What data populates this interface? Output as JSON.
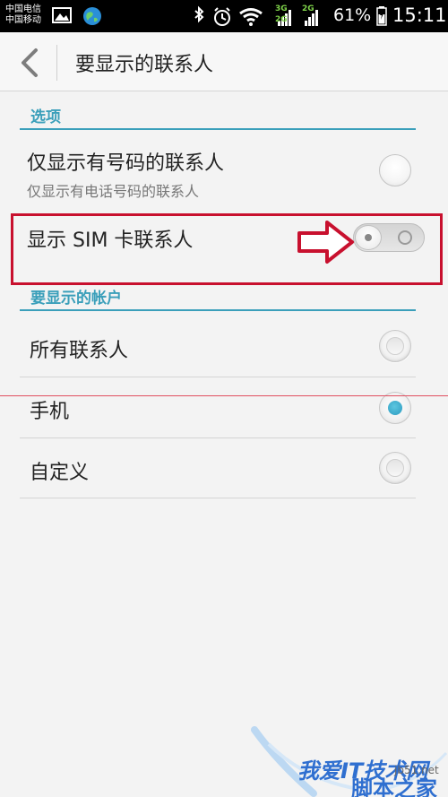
{
  "status_bar": {
    "carrier_1": "中国电信",
    "carrier_2": "中国移动",
    "battery_percent": "61%",
    "time": "15:11",
    "net_label_1": "3G",
    "net_label_2": "2G",
    "net_label_3": "2G",
    "icons": [
      "image-icon",
      "globe-icon",
      "bluetooth-icon",
      "alarm-icon",
      "wifi-icon",
      "signal-icon",
      "battery-icon"
    ]
  },
  "header": {
    "title": "要显示的联系人",
    "back_icon": "chevron-left-icon"
  },
  "section_options": {
    "label": "选项",
    "items": [
      {
        "title": "仅显示有号码的联系人",
        "subtitle": "仅显示有电话号码的联系人",
        "control": "radio",
        "selected": false
      },
      {
        "title": "显示 SIM 卡联系人",
        "control": "toggle",
        "on": false
      }
    ]
  },
  "section_accounts": {
    "label": "要显示的帐户",
    "items": [
      {
        "title": "所有联系人",
        "selected": false
      },
      {
        "title": "手机",
        "selected": true
      },
      {
        "title": "自定义",
        "selected": false
      }
    ]
  },
  "watermark": {
    "line1": "我爱IT技术网",
    "line2": "jb51.net",
    "line3": "脚本之家"
  },
  "colors": {
    "accent": "#3a9fba",
    "annotation_red": "#c8102e",
    "radio_selected": "#2d9bc0"
  }
}
